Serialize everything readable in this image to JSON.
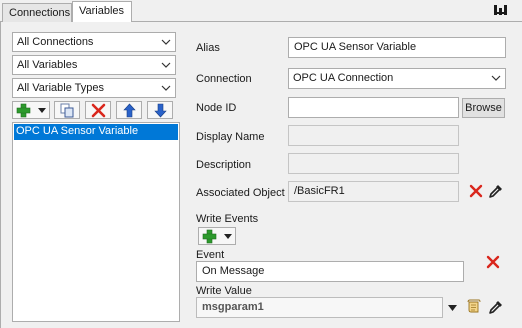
{
  "tabs": [
    {
      "label": "Connections",
      "active": false
    },
    {
      "label": "Variables",
      "active": true
    }
  ],
  "filters": {
    "connections": "All Connections",
    "variables": "All Variables",
    "variable_types": "All Variable Types"
  },
  "toolbar": {
    "icons": [
      "add-icon",
      "dropdown-arrow-icon",
      "duplicate-icon",
      "delete-icon",
      "move-up-icon",
      "move-down-icon"
    ]
  },
  "variable_list": {
    "items": [
      {
        "label": "OPC UA Sensor Variable",
        "selected": true
      }
    ]
  },
  "form": {
    "alias_label": "Alias",
    "alias_value": "OPC UA Sensor Variable",
    "connection_label": "Connection",
    "connection_value": "OPC UA Connection",
    "node_id_label": "Node ID",
    "node_id_value": "",
    "browse_label": "Browse",
    "display_name_label": "Display Name",
    "display_name_value": "",
    "description_label": "Description",
    "description_value": "",
    "associated_object_label": "Associated Object",
    "associated_object_value": "/BasicFR1",
    "write_events_label": "Write Events",
    "event_label": "Event",
    "event_value": "On Message",
    "write_value_label": "Write Value",
    "write_value_value": "msgparam1"
  },
  "colors": {
    "selection": "#0078d7",
    "delete_red": "#d9261c",
    "add_green": "#2c9a2c",
    "arrow_blue": "#2a62c9"
  }
}
